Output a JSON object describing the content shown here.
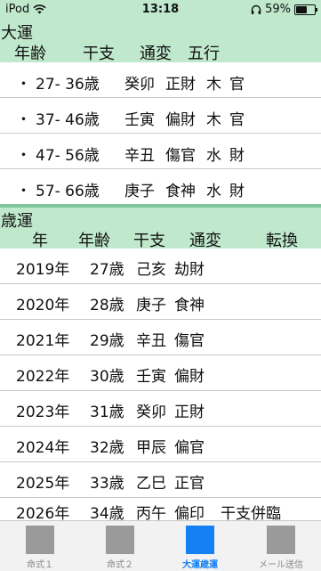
{
  "status": {
    "device": "iPod",
    "time": "13:18",
    "battery": "59%",
    "battery_level": 0.59
  },
  "daiun": {
    "title": "大運",
    "headers": [
      "年齢",
      "干支",
      "通変",
      "五行"
    ],
    "rows": [
      {
        "bullet": "・",
        "age": "27- 36歳",
        "kanshi": "癸卯",
        "tsuhen": "正財",
        "gogyo": "木",
        "extra": "官"
      },
      {
        "bullet": "・",
        "age": "37- 46歳",
        "kanshi": "壬寅",
        "tsuhen": "偏財",
        "gogyo": "木",
        "extra": "官"
      },
      {
        "bullet": "・",
        "age": "47- 56歳",
        "kanshi": "辛丑",
        "tsuhen": "傷官",
        "gogyo": "水",
        "extra": "財"
      },
      {
        "bullet": "・",
        "age": "57- 66歳",
        "kanshi": "庚子",
        "tsuhen": "食神",
        "gogyo": "水",
        "extra": "財"
      }
    ]
  },
  "saiun": {
    "title": "歳運",
    "headers": [
      "年",
      "年齢",
      "干支",
      "通変",
      "転換"
    ],
    "rows": [
      {
        "year": "2019年",
        "age": "27歳",
        "kanshi": "己亥",
        "tsuhen": "劫財",
        "tenkan": ""
      },
      {
        "year": "2020年",
        "age": "28歳",
        "kanshi": "庚子",
        "tsuhen": "食神",
        "tenkan": ""
      },
      {
        "year": "2021年",
        "age": "29歳",
        "kanshi": "辛丑",
        "tsuhen": "傷官",
        "tenkan": ""
      },
      {
        "year": "2022年",
        "age": "30歳",
        "kanshi": "壬寅",
        "tsuhen": "偏財",
        "tenkan": ""
      },
      {
        "year": "2023年",
        "age": "31歳",
        "kanshi": "癸卯",
        "tsuhen": "正財",
        "tenkan": ""
      },
      {
        "year": "2024年",
        "age": "32歳",
        "kanshi": "甲辰",
        "tsuhen": "偏官",
        "tenkan": ""
      },
      {
        "year": "2025年",
        "age": "33歳",
        "kanshi": "乙巳",
        "tsuhen": "正官",
        "tenkan": ""
      },
      {
        "year": "2026年",
        "age": "34歳",
        "kanshi": "丙午",
        "tsuhen": "偏印",
        "tenkan": "干支併臨"
      }
    ]
  },
  "tabs": [
    {
      "label": "命式１",
      "active": false
    },
    {
      "label": "命式２",
      "active": false
    },
    {
      "label": "大運歳運",
      "active": true
    },
    {
      "label": "メール送信",
      "active": false
    }
  ],
  "colors": {
    "header_bg": "#bfe8cc",
    "separator": "#7fc79a",
    "active_tab": "#1380f5",
    "inactive_icon": "#9a9a9a"
  }
}
